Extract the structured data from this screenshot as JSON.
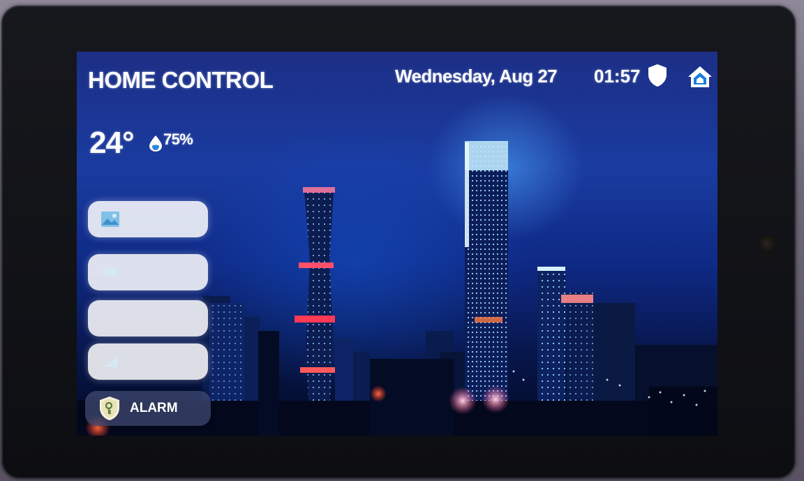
{
  "header": {
    "title": "HOME CONTROL",
    "date": "Wednesday, Aug 27",
    "time": "01:57"
  },
  "weather": {
    "temperature": "24°",
    "humidity": "75%"
  },
  "menu": {
    "items": [
      {
        "icon": "image-icon",
        "label": ""
      },
      {
        "icon": "scenes-icon",
        "label": ""
      },
      {
        "icon": "blank",
        "label": ""
      },
      {
        "icon": "network-icon",
        "label": ""
      }
    ],
    "alarm": {
      "icon": "shield-key-icon",
      "label": "ALARM"
    }
  },
  "colors": {
    "accent": "#1f6fd6",
    "button_bg": "#f2f6fa",
    "alarm_bg": "#3c466e",
    "text": "#ffffff"
  }
}
